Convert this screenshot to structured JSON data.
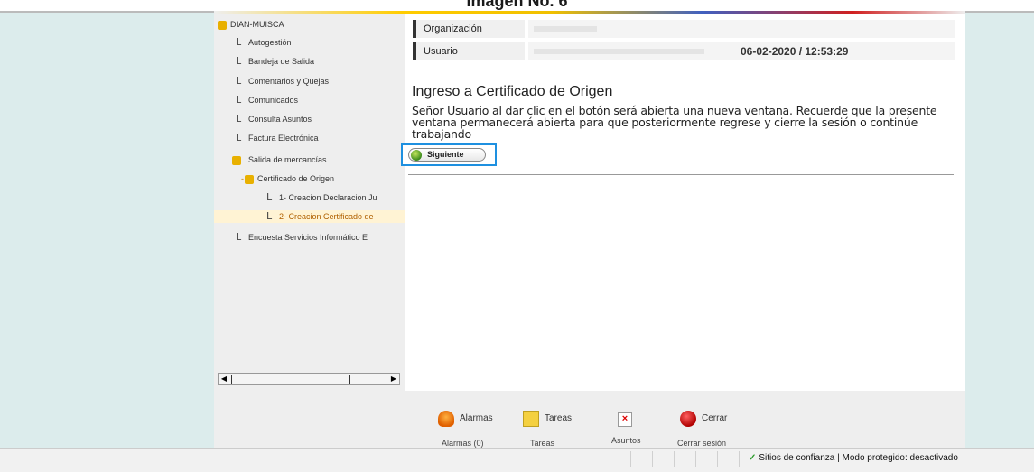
{
  "caption": "Imagen No. 6",
  "tree": {
    "items": [
      {
        "label": "DIAN-MUISCA",
        "type": "root"
      },
      {
        "label": "Autogestión"
      },
      {
        "label": "Bandeja de Salida"
      },
      {
        "label": "Comentarios y Quejas"
      },
      {
        "label": "Comunicados"
      },
      {
        "label": "Consulta Asuntos"
      },
      {
        "label": "Factura Electrónica"
      },
      {
        "label": "Salida de mercancías",
        "type": "folder"
      },
      {
        "label": "Certificado de Origen",
        "type": "subfolder"
      },
      {
        "label": "1- Creacion Declaracion Ju"
      },
      {
        "label": "2- Creacion Certificado de",
        "selected": true
      },
      {
        "label": "Encuesta Servicios Informático E"
      }
    ],
    "expand_marker": "-"
  },
  "header": {
    "organizacion_label": "Organización",
    "usuario_label": "Usuario",
    "datetime": "06-02-2020 / 12:53:29"
  },
  "main": {
    "title": "Ingreso a Certificado de Origen",
    "message": "Señor Usuario al dar clic en el botón será abierta una nueva ventana. Recuerde que la presente ventana permanecerá abierta para que posteriormente regrese y cierre la sesión o continúe trabajando",
    "next_label": "Siguiente"
  },
  "toolbar": {
    "alarmas": "Alarmas",
    "tareas": "Tareas",
    "alarmas_caption": "Alarmas (0)",
    "tareas_caption": "Tareas",
    "asuntos_caption": "Asuntos",
    "cerrar": "Cerrar",
    "cerrar_caption": "Cerrar sesión"
  },
  "statusbar": {
    "zone_text": "Sitios de confianza | Modo protegido: desactivado"
  }
}
